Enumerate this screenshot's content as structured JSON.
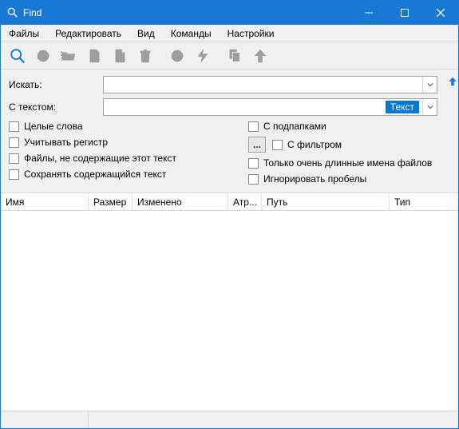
{
  "window": {
    "title": "Find"
  },
  "menubar": {
    "items": [
      "Файлы",
      "Редактировать",
      "Вид",
      "Команды",
      "Настройки"
    ]
  },
  "form": {
    "search_label": "Искать:",
    "search_value": "",
    "text_label": "С текстом:",
    "text_value": "",
    "text_select_label": "Текст"
  },
  "options": {
    "left": [
      "Целые слова",
      "Учитывать регистр",
      "Файлы, не содержащие этот текст",
      "Сохранять содержащийся текст"
    ],
    "right": [
      "С подпапками",
      "С фильтром",
      "Только очень длинные имена файлов",
      "Игнорировать пробелы"
    ],
    "dots": "..."
  },
  "columns": {
    "name": "Имя",
    "size": "Размер",
    "modified": "Изменено",
    "attr": "Атр...",
    "path": "Путь",
    "type": "Тип"
  }
}
